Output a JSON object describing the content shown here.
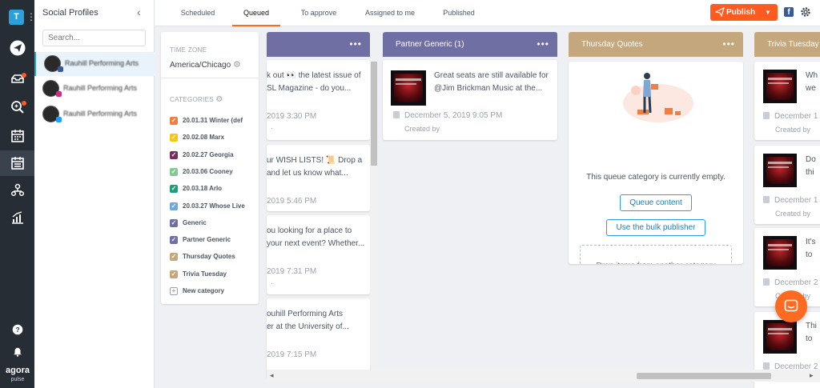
{
  "rail": {
    "avatar": "T"
  },
  "brand": {
    "line1": "agora",
    "line2": "pulse"
  },
  "profiles": {
    "title": "Social Profiles",
    "search_placeholder": "Search...",
    "items": [
      {
        "name": "Rauhill Performing Arts",
        "network": "facebook",
        "color": "#3b5998"
      },
      {
        "name": "Rauhill Performing Arts",
        "network": "instagram",
        "color": "#c13584"
      },
      {
        "name": "Rauhill Performing Arts",
        "network": "twitter",
        "color": "#1da1f2"
      }
    ]
  },
  "tabs": [
    "Scheduled",
    "Queued",
    "To approve",
    "Assigned to me",
    "Published"
  ],
  "active_tab": "Queued",
  "publish_label": "Publish",
  "timezone": {
    "label": "TIME ZONE",
    "value": "America/Chicago"
  },
  "categories": {
    "label": "CATEGORIES",
    "items": [
      {
        "name": "20.01.31 Winter  (def",
        "color": "#f47c3c"
      },
      {
        "name": "20.02.08 Marx",
        "color": "#f5c518"
      },
      {
        "name": "20.02.27 Georgia",
        "color": "#7a2e5c"
      },
      {
        "name": "20.03.06 Cooney",
        "color": "#82c995"
      },
      {
        "name": "20.03.18 Arlo",
        "color": "#1e9e7a"
      },
      {
        "name": "20.03.27 Whose Live",
        "color": "#6fa8dc"
      },
      {
        "name": "Generic",
        "color": "#6f6fa3"
      },
      {
        "name": "Partner Generic",
        "color": "#6f6fa3"
      },
      {
        "name": "Thursday Quotes",
        "color": "#c4a77d"
      },
      {
        "name": "Trivia Tuesday",
        "color": "#c4a77d"
      }
    ],
    "new_label": "New category"
  },
  "col_generic": {
    "color": "#6f6fa3",
    "cards": [
      {
        "line1": "k out 👀 the latest issue of",
        "line2": "SL Magazine - do you...",
        "date": "2019 3:30 PM",
        "by": "·"
      },
      {
        "line1": "ur WISH LISTS! 📜 Drop a",
        "line2": "and let us know what...",
        "date": "2019 5:46 PM",
        "by": "·"
      },
      {
        "line1": "ou looking for a place to",
        "line2": "your next event? Whether...",
        "date": "2019 7:31 PM",
        "by": "·"
      },
      {
        "line1": "ouhill Performing Arts",
        "line2": "er at the University of...",
        "date": "2019 7:15 PM",
        "by": ""
      }
    ]
  },
  "col_partner": {
    "title": "Partner Generic  (1)",
    "color": "#6f6fa3",
    "card": {
      "line1": "Great seats are still available for",
      "line2": "@Jim Brickman Music at the...",
      "date": "December 5, 2019 9:05 PM",
      "by": "Created by"
    }
  },
  "col_thursday": {
    "title": "Thursday Quotes",
    "color": "#c4a77d",
    "empty_text": "This queue category is currently empty.",
    "queue_btn": "Queue content",
    "bulk_btn": "Use the bulk publisher",
    "drop_text": "Drop items from another category"
  },
  "col_trivia": {
    "title": "Trivia Tuesday",
    "color": "#c4a77d",
    "cards": [
      {
        "text1": "Wh",
        "text2": "we",
        "date": "December 1",
        "by": "Created by"
      },
      {
        "text1": "Do",
        "text2": "thi",
        "date": "December 1",
        "by": "Created by"
      },
      {
        "text1": "It's",
        "text2": "to",
        "date": "December 2",
        "by": "Created by"
      },
      {
        "text1": "Thi",
        "text2": "to",
        "date": "December 2",
        "by": ""
      }
    ]
  }
}
